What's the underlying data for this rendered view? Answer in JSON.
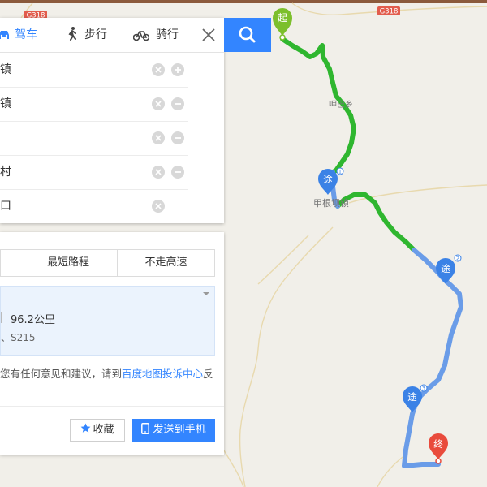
{
  "map": {
    "road_badges": [
      "G318",
      "G318"
    ],
    "place_labels": [
      "呷巴乡",
      "甲根坝镇"
    ],
    "markers": {
      "start": "起",
      "end": "终",
      "via": [
        {
          "label": "途",
          "index": "1"
        },
        {
          "label": "途",
          "index": "2"
        },
        {
          "label": "途",
          "index": "3"
        }
      ]
    },
    "colors": {
      "smooth": "#2fb62f",
      "route": "#6a9ce8",
      "start": "#7cbf2c",
      "end": "#e94b3c",
      "via": "#3b82e6"
    }
  },
  "modes": {
    "drive": "驾车",
    "walk": "步行",
    "bike": "骑行"
  },
  "stops": [
    "镇",
    "镇",
    "",
    "村",
    "口"
  ],
  "options": {
    "tabs": [
      "",
      "最短路程",
      "不走高速"
    ]
  },
  "route": {
    "distance": "96.2公里",
    "via_roads": "、S215"
  },
  "feedback": {
    "text": "您有任何意见和建议，请到",
    "link": "百度地图投诉中心",
    "suffix": "反"
  },
  "actions": {
    "favorite": "收藏",
    "send_to_phone": "发送到手机"
  }
}
